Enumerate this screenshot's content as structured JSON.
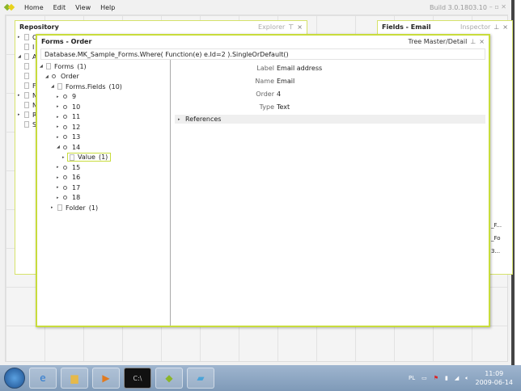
{
  "menu": {
    "items": [
      "Home",
      "Edit",
      "View",
      "Help"
    ],
    "build": "Build 3.0.1803.10",
    "window_controls": "– ▫ ✕"
  },
  "repository": {
    "title": "Repository",
    "mode": "Explorer",
    "pin": "⊤",
    "close": "×",
    "items": [
      {
        "label": "C",
        "expand": "▸"
      },
      {
        "label": "I",
        "expand": ""
      },
      {
        "label": "A",
        "expand": "◢"
      },
      {
        "label": "",
        "expand": ""
      },
      {
        "label": "",
        "expand": ""
      },
      {
        "label": "F",
        "expand": ""
      },
      {
        "label": "N",
        "expand": "▸"
      },
      {
        "label": "N",
        "expand": ""
      },
      {
        "label": "R",
        "expand": "▸"
      },
      {
        "label": "S",
        "expand": ""
      }
    ]
  },
  "fields": {
    "title": "Fields - Email",
    "mode": "Inspector",
    "pin": "⊥",
    "close": "×",
    "clipped": [
      "_F...",
      "_Fo",
      "3..."
    ]
  },
  "dialog": {
    "title": "Forms - Order",
    "mode": "Tree Master/Detail",
    "pin": "⊥",
    "close": "×",
    "query": "Database.MK_Sample_Forms.Where( Function(e) e.Id=2 ).SingleOrDefault()",
    "tree": [
      {
        "label": "Forms",
        "count": "(1)",
        "depth": 0,
        "icon": "doc",
        "arrow": "◢"
      },
      {
        "label": "Order",
        "count": "",
        "depth": 1,
        "icon": "mag",
        "arrow": "◢"
      },
      {
        "label": "Forms.Fields",
        "count": "(10)",
        "depth": 2,
        "icon": "doc",
        "arrow": "◢"
      },
      {
        "label": "9",
        "count": "",
        "depth": 3,
        "icon": "mag",
        "arrow": "▸"
      },
      {
        "label": "10",
        "count": "",
        "depth": 3,
        "icon": "mag",
        "arrow": "▸"
      },
      {
        "label": "11",
        "count": "",
        "depth": 3,
        "icon": "mag",
        "arrow": "▸"
      },
      {
        "label": "12",
        "count": "",
        "depth": 3,
        "icon": "mag",
        "arrow": "▸"
      },
      {
        "label": "13",
        "count": "",
        "depth": 3,
        "icon": "mag",
        "arrow": "▸"
      },
      {
        "label": "14",
        "count": "",
        "depth": 3,
        "icon": "mag",
        "arrow": "◢"
      },
      {
        "label": "Value",
        "count": "(1)",
        "depth": 4,
        "icon": "doc",
        "arrow": "▸",
        "selected": true
      },
      {
        "label": "15",
        "count": "",
        "depth": 3,
        "icon": "mag",
        "arrow": "▸"
      },
      {
        "label": "16",
        "count": "",
        "depth": 3,
        "icon": "mag",
        "arrow": "▸"
      },
      {
        "label": "17",
        "count": "",
        "depth": 3,
        "icon": "mag",
        "arrow": "▸"
      },
      {
        "label": "18",
        "count": "",
        "depth": 3,
        "icon": "mag",
        "arrow": "▸"
      },
      {
        "label": "Folder",
        "count": "(1)",
        "depth": 2,
        "icon": "doc",
        "arrow": "▸"
      }
    ],
    "properties": [
      {
        "label": "Label",
        "value": "Email address"
      },
      {
        "label": "Name",
        "value": "Email"
      },
      {
        "label": "Order",
        "value": "4"
      },
      {
        "label": "Type",
        "value": "Text"
      }
    ],
    "references": "References"
  },
  "taskbar": {
    "lang": "PL",
    "time": "11:09",
    "date": "2009-06-14"
  }
}
